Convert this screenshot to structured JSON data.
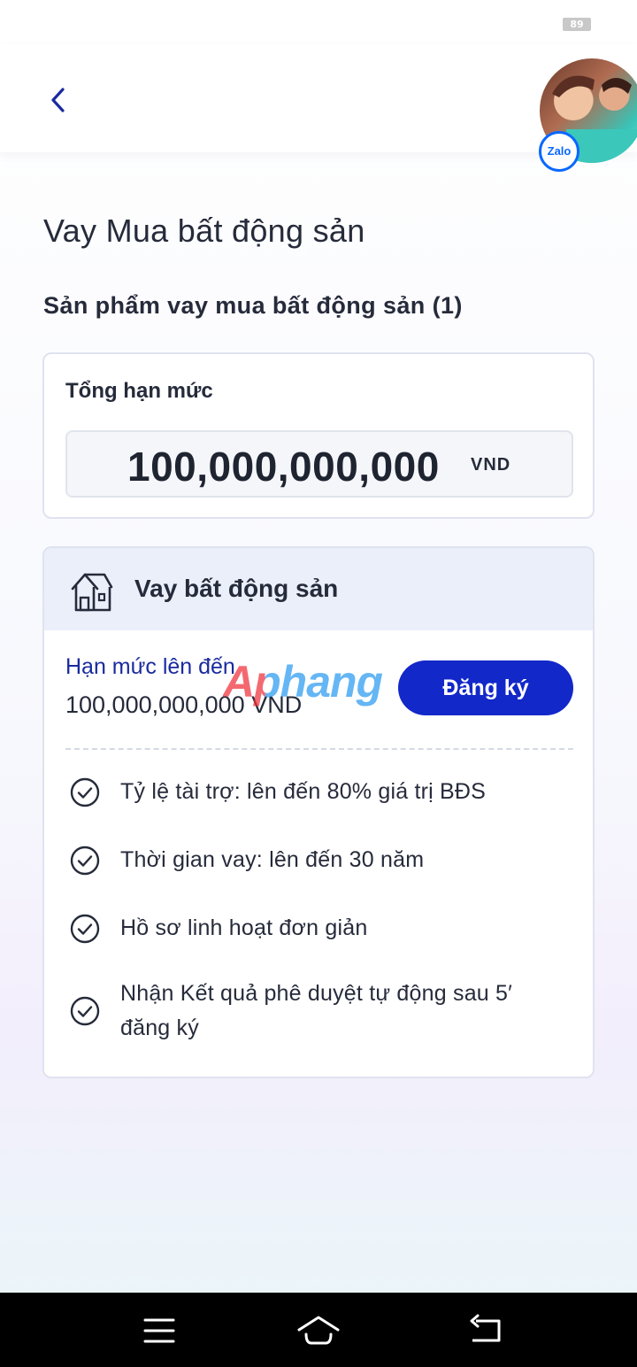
{
  "status_bar": {
    "battery": "89"
  },
  "header": {
    "avatar_badge": "Zalo"
  },
  "page": {
    "title": "Vay Mua bất động sản",
    "section_title": "Sản phẩm vay mua bất động sản (1)"
  },
  "total_card": {
    "label": "Tổng hạn mức",
    "amount": "100,000,000,000",
    "unit": "VND"
  },
  "product": {
    "name": "Vay bất động sản",
    "limit_label": "Hạn mức lên đến",
    "limit_value": "100,000,000,000 VND",
    "register_label": "Đăng ký",
    "features": [
      "Tỷ lệ tài trợ: lên đến 80% giá trị BĐS",
      "Thời gian vay: lên đến 30 năm",
      "Hồ sơ linh hoạt đơn giản",
      "Nhận Kết quả phê duyệt tự động sau 5′ đăng ký"
    ]
  },
  "watermark": "Aphang",
  "colors": {
    "primary": "#1228c9",
    "link_text": "#1a2b9e",
    "card_header": "#eaeffa",
    "text": "#262b3b"
  },
  "icons": {
    "back": "chevron-left-icon",
    "product": "house-icon",
    "feature": "check-circle-icon",
    "nav": [
      "menu-icon",
      "home-icon",
      "back-arrow-icon"
    ]
  }
}
